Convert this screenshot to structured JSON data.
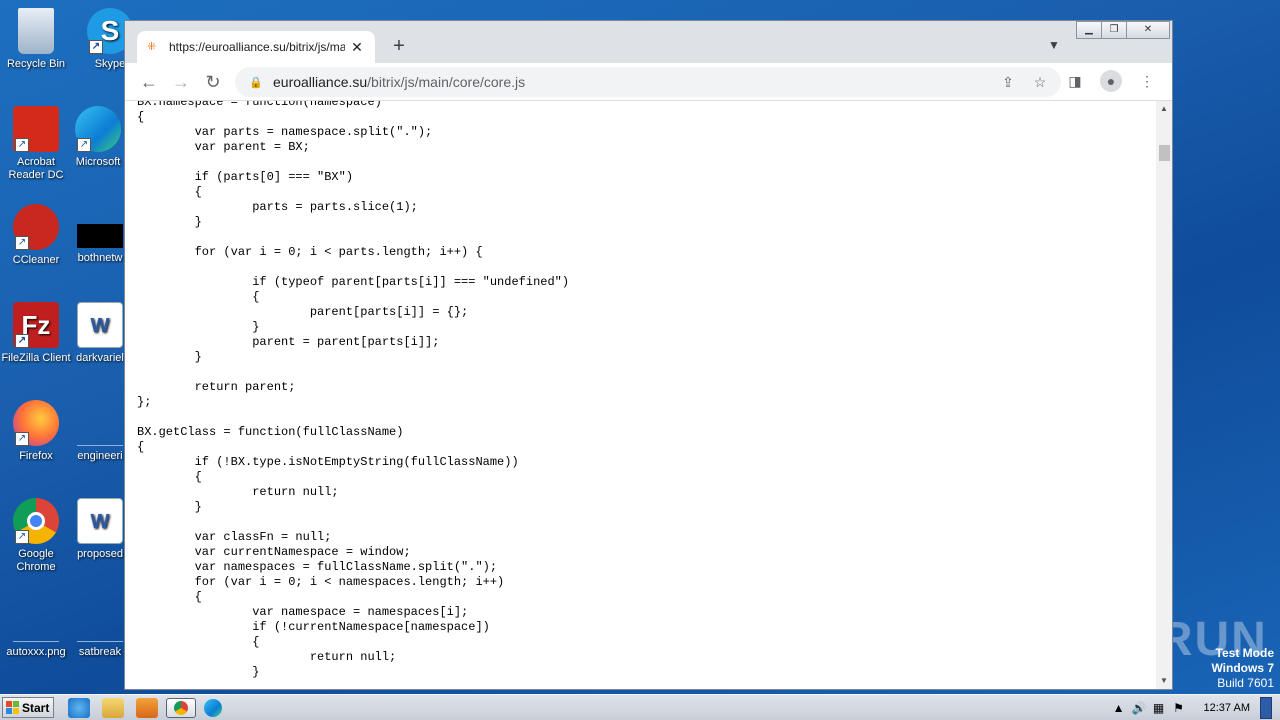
{
  "desktop": {
    "icons": [
      {
        "label": "Recycle Bin"
      },
      {
        "label": "Skype"
      },
      {
        "label": "Acrobat Reader DC"
      },
      {
        "label": "Microsoft"
      },
      {
        "label": "CCleaner"
      },
      {
        "label": "bothnetw"
      },
      {
        "label": "FileZilla Client"
      },
      {
        "label": "darkvariel"
      },
      {
        "label": "Firefox"
      },
      {
        "label": "engineeri"
      },
      {
        "label": "Google Chrome"
      },
      {
        "label": "proposed"
      },
      {
        "label": "autoxxx.png"
      },
      {
        "label": "satbreak"
      }
    ]
  },
  "browser": {
    "tab_title": "https://euroalliance.su/bitrix/js/main",
    "url_host": "euroalliance.su",
    "url_path": "/bitrix/js/main/core/core.js",
    "code": "BX.namespace = function(namespace)\n{\n\tvar parts = namespace.split(\".\");\n\tvar parent = BX;\n\n\tif (parts[0] === \"BX\")\n\t{\n\t\tparts = parts.slice(1);\n\t}\n\n\tfor (var i = 0; i < parts.length; i++) {\n\n\t\tif (typeof parent[parts[i]] === \"undefined\")\n\t\t{\n\t\t\tparent[parts[i]] = {};\n\t\t}\n\t\tparent = parent[parts[i]];\n\t}\n\n\treturn parent;\n};\n\nBX.getClass = function(fullClassName)\n{\n\tif (!BX.type.isNotEmptyString(fullClassName))\n\t{\n\t\treturn null;\n\t}\n\n\tvar classFn = null;\n\tvar currentNamespace = window;\n\tvar namespaces = fullClassName.split(\".\");\n\tfor (var i = 0; i < namespaces.length; i++)\n\t{\n\t\tvar namespace = namespaces[i];\n\t\tif (!currentNamespace[namespace])\n\t\t{\n\t\t\treturn null;\n\t\t}"
  },
  "taskbar": {
    "start_label": "Start",
    "clock": "12:37 AM"
  },
  "watermark": {
    "logo": "ANY RUN",
    "test_mode": "Test Mode",
    "os": "Windows 7",
    "build": "Build 7601"
  },
  "colors": {
    "desktop_bg": "#1a5fae",
    "chrome_frame": "#dee1e6"
  }
}
